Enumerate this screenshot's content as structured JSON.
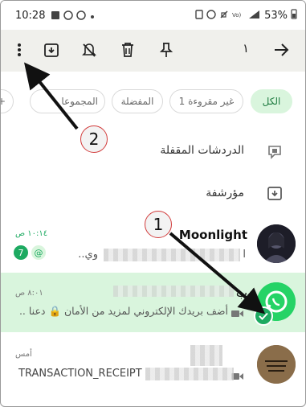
{
  "status_bar": {
    "time": "10:28",
    "battery": "53%"
  },
  "toolbar": {
    "selected_count": "١",
    "icons": [
      "more-vert-icon",
      "archive-icon",
      "mute-icon",
      "delete-icon",
      "pin-icon",
      "back-arrow-icon"
    ]
  },
  "filters": [
    {
      "label": "الكل",
      "active": true
    },
    {
      "label": "غير مقروءة 1",
      "active": false
    },
    {
      "label": "المفضلة",
      "active": false
    },
    {
      "label": "المجموعا",
      "active": false
    }
  ],
  "add_filter_label": "+",
  "locked_chats": {
    "label": "الدردشات المقفلة",
    "icon": "locked-chat-icon"
  },
  "archived": {
    "label": "مؤرشفة",
    "icon": "archive-box-icon"
  },
  "chats": [
    {
      "name": "Moonlight",
      "time": "١٠:١٤ ص",
      "preview": "وي..",
      "unread": "7",
      "mention": "@"
    },
    {
      "name": "ب",
      "time": "٨:٠١ ص",
      "preview": "أضف بريدك الإلكتروني لمزيد من الأمان 🔒 دعنا ..",
      "selected": true
    },
    {
      "name": "",
      "time": "أمس",
      "preview": "TRANSACTION_RECEIPT"
    }
  ],
  "annotations": {
    "marker_1": "1",
    "marker_2": "2"
  },
  "colors": {
    "accent": "#1daa61",
    "selected_row": "#d9f5dd",
    "toolbar_bg": "#f0f0ec",
    "annotation_red": "#d23b3b"
  }
}
